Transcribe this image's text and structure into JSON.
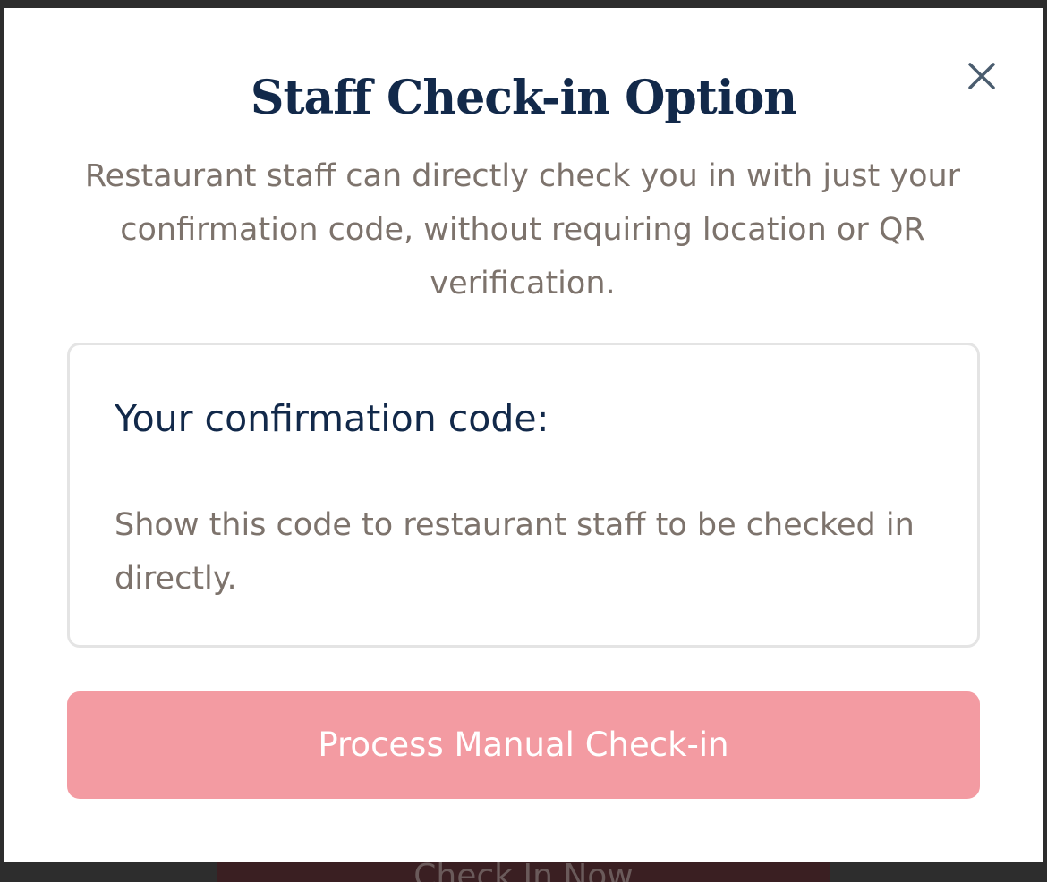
{
  "modal": {
    "title": "Staff Check-in Option",
    "description": "Restaurant staff can directly check you in with just your confirmation code, without requiring location or QR verification.",
    "close_icon": "close-icon",
    "code_card": {
      "heading": "Your confirmation code:",
      "help_text": "Show this code to restaurant staff to be checked in directly."
    },
    "primary_button_label": "Process Manual Check-in"
  },
  "background": {
    "button_label": "Check In Now"
  },
  "colors": {
    "title": "#12294a",
    "body_text": "#7d736c",
    "primary_button": "#f39ba2",
    "close_icon": "#4a5c6e"
  }
}
